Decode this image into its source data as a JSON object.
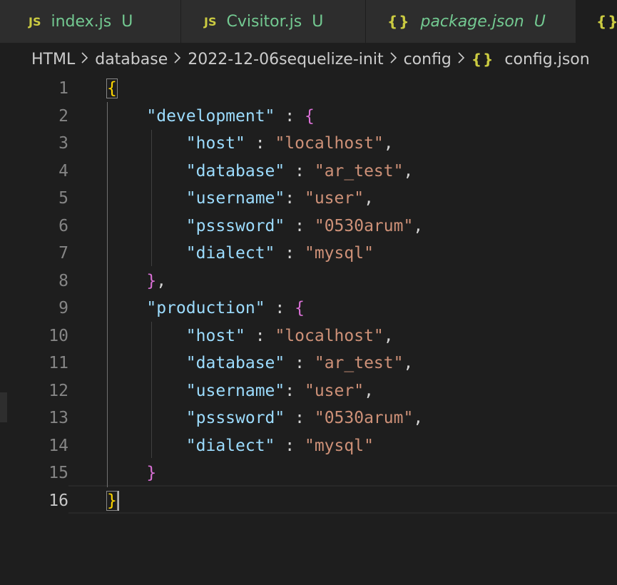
{
  "tabs": [
    {
      "icon": "JS",
      "name": "index.js",
      "status": "U",
      "italic": false
    },
    {
      "icon": "JS",
      "name": "Cvisitor.js",
      "status": "U",
      "italic": false
    },
    {
      "icon": "{}",
      "name": "package.json",
      "status": "U",
      "italic": true
    },
    {
      "icon": "{}",
      "name": "",
      "status": "",
      "italic": false
    }
  ],
  "breadcrumb": {
    "segments": [
      "HTML",
      "database",
      "2022-12-06sequelize-init",
      "config"
    ],
    "file_icon": "{}",
    "file": "config.json",
    "separator": ">"
  },
  "editor": {
    "line_numbers": [
      "1",
      "2",
      "3",
      "4",
      "5",
      "6",
      "7",
      "8",
      "9",
      "10",
      "11",
      "12",
      "13",
      "14",
      "15",
      "16"
    ],
    "current_line": "16",
    "lines": [
      "{",
      "    \"development\" : {",
      "        \"host\" : \"localhost\",",
      "        \"database\" : \"ar_test\",",
      "        \"username\": \"user\",",
      "        \"psssword\" : \"0530arum\",",
      "        \"dialect\" : \"mysql\"",
      "    },",
      "    \"production\" : {",
      "        \"host\" : \"localhost\",",
      "        \"database\" : \"ar_test\",",
      "        \"username\": \"user\",",
      "        \"psssword\" : \"0530arum\",",
      "        \"dialect\" : \"mysql\"",
      "    }",
      "}"
    ]
  },
  "colors": {
    "background": "#1e1e1e",
    "key": "#9cdcfe",
    "string": "#ce9178",
    "brace_level1": "#ffd700",
    "brace_level2": "#da70d6",
    "untracked": "#73c991",
    "json_icon": "#cbcb41"
  }
}
